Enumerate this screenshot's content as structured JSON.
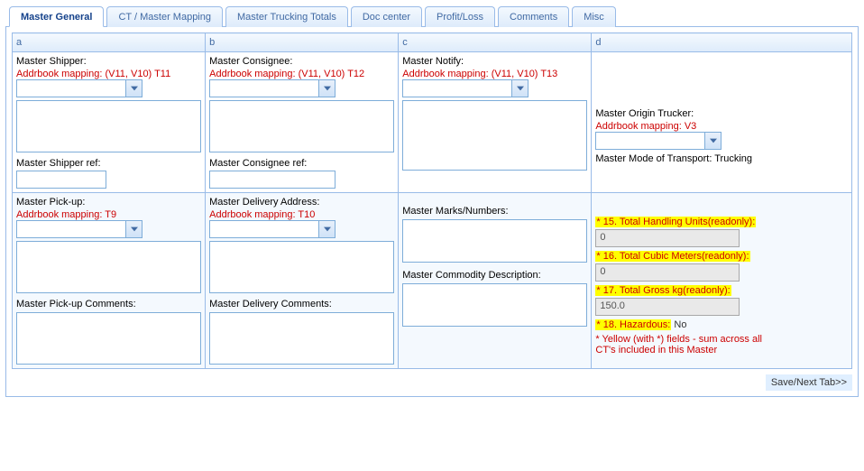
{
  "tabs": {
    "t0": "Master General",
    "t1": "CT / Master Mapping",
    "t2": "Master Trucking Totals",
    "t3": "Doc center",
    "t4": "Profit/Loss",
    "t5": "Comments",
    "t6": "Misc"
  },
  "headers": {
    "a": "a",
    "b": "b",
    "c": "c",
    "d": "d"
  },
  "colA": {
    "shipper_lbl": "Master Shipper:",
    "shipper_map": "Addrbook mapping: (V11, V10) T11",
    "shipper_ref_lbl": "Master Shipper ref:",
    "pickup_lbl": "Master Pick-up:",
    "pickup_map": "Addrbook mapping: T9",
    "pickup_comments_lbl": "Master Pick-up Comments:"
  },
  "colB": {
    "consignee_lbl": "Master Consignee:",
    "consignee_map": "Addrbook mapping: (V11, V10) T12",
    "consignee_ref_lbl": "Master Consignee ref:",
    "delivery_lbl": "Master Delivery Address:",
    "delivery_map": "Addrbook mapping: T10",
    "delivery_comments_lbl": "Master Delivery Comments:"
  },
  "colC": {
    "notify_lbl": "Master Notify:",
    "notify_map": "Addrbook mapping: (V11, V10) T13",
    "marks_lbl": "Master Marks/Numbers:",
    "commodity_lbl": "Master Commodity Description:"
  },
  "colD": {
    "origin_trucker_lbl": "Master Origin Trucker:",
    "origin_trucker_map": "Addrbook mapping: V3",
    "mode_lbl": "Master Mode of Transport: Trucking",
    "f15_lbl": "* 15. Total Handling Units(readonly):",
    "f15_val": "0",
    "f16_lbl": "* 16. Total Cubic Meters(readonly):",
    "f16_val": "0",
    "f17_lbl": "* 17. Total Gross kg(readonly):",
    "f17_val": "150.0",
    "f18_lbl": "* 18. Hazardous:",
    "f18_val": "No",
    "note": "* Yellow (with *) fields - sum across all CT's included in this Master"
  },
  "footer": {
    "save": "Save/Next Tab>>"
  }
}
